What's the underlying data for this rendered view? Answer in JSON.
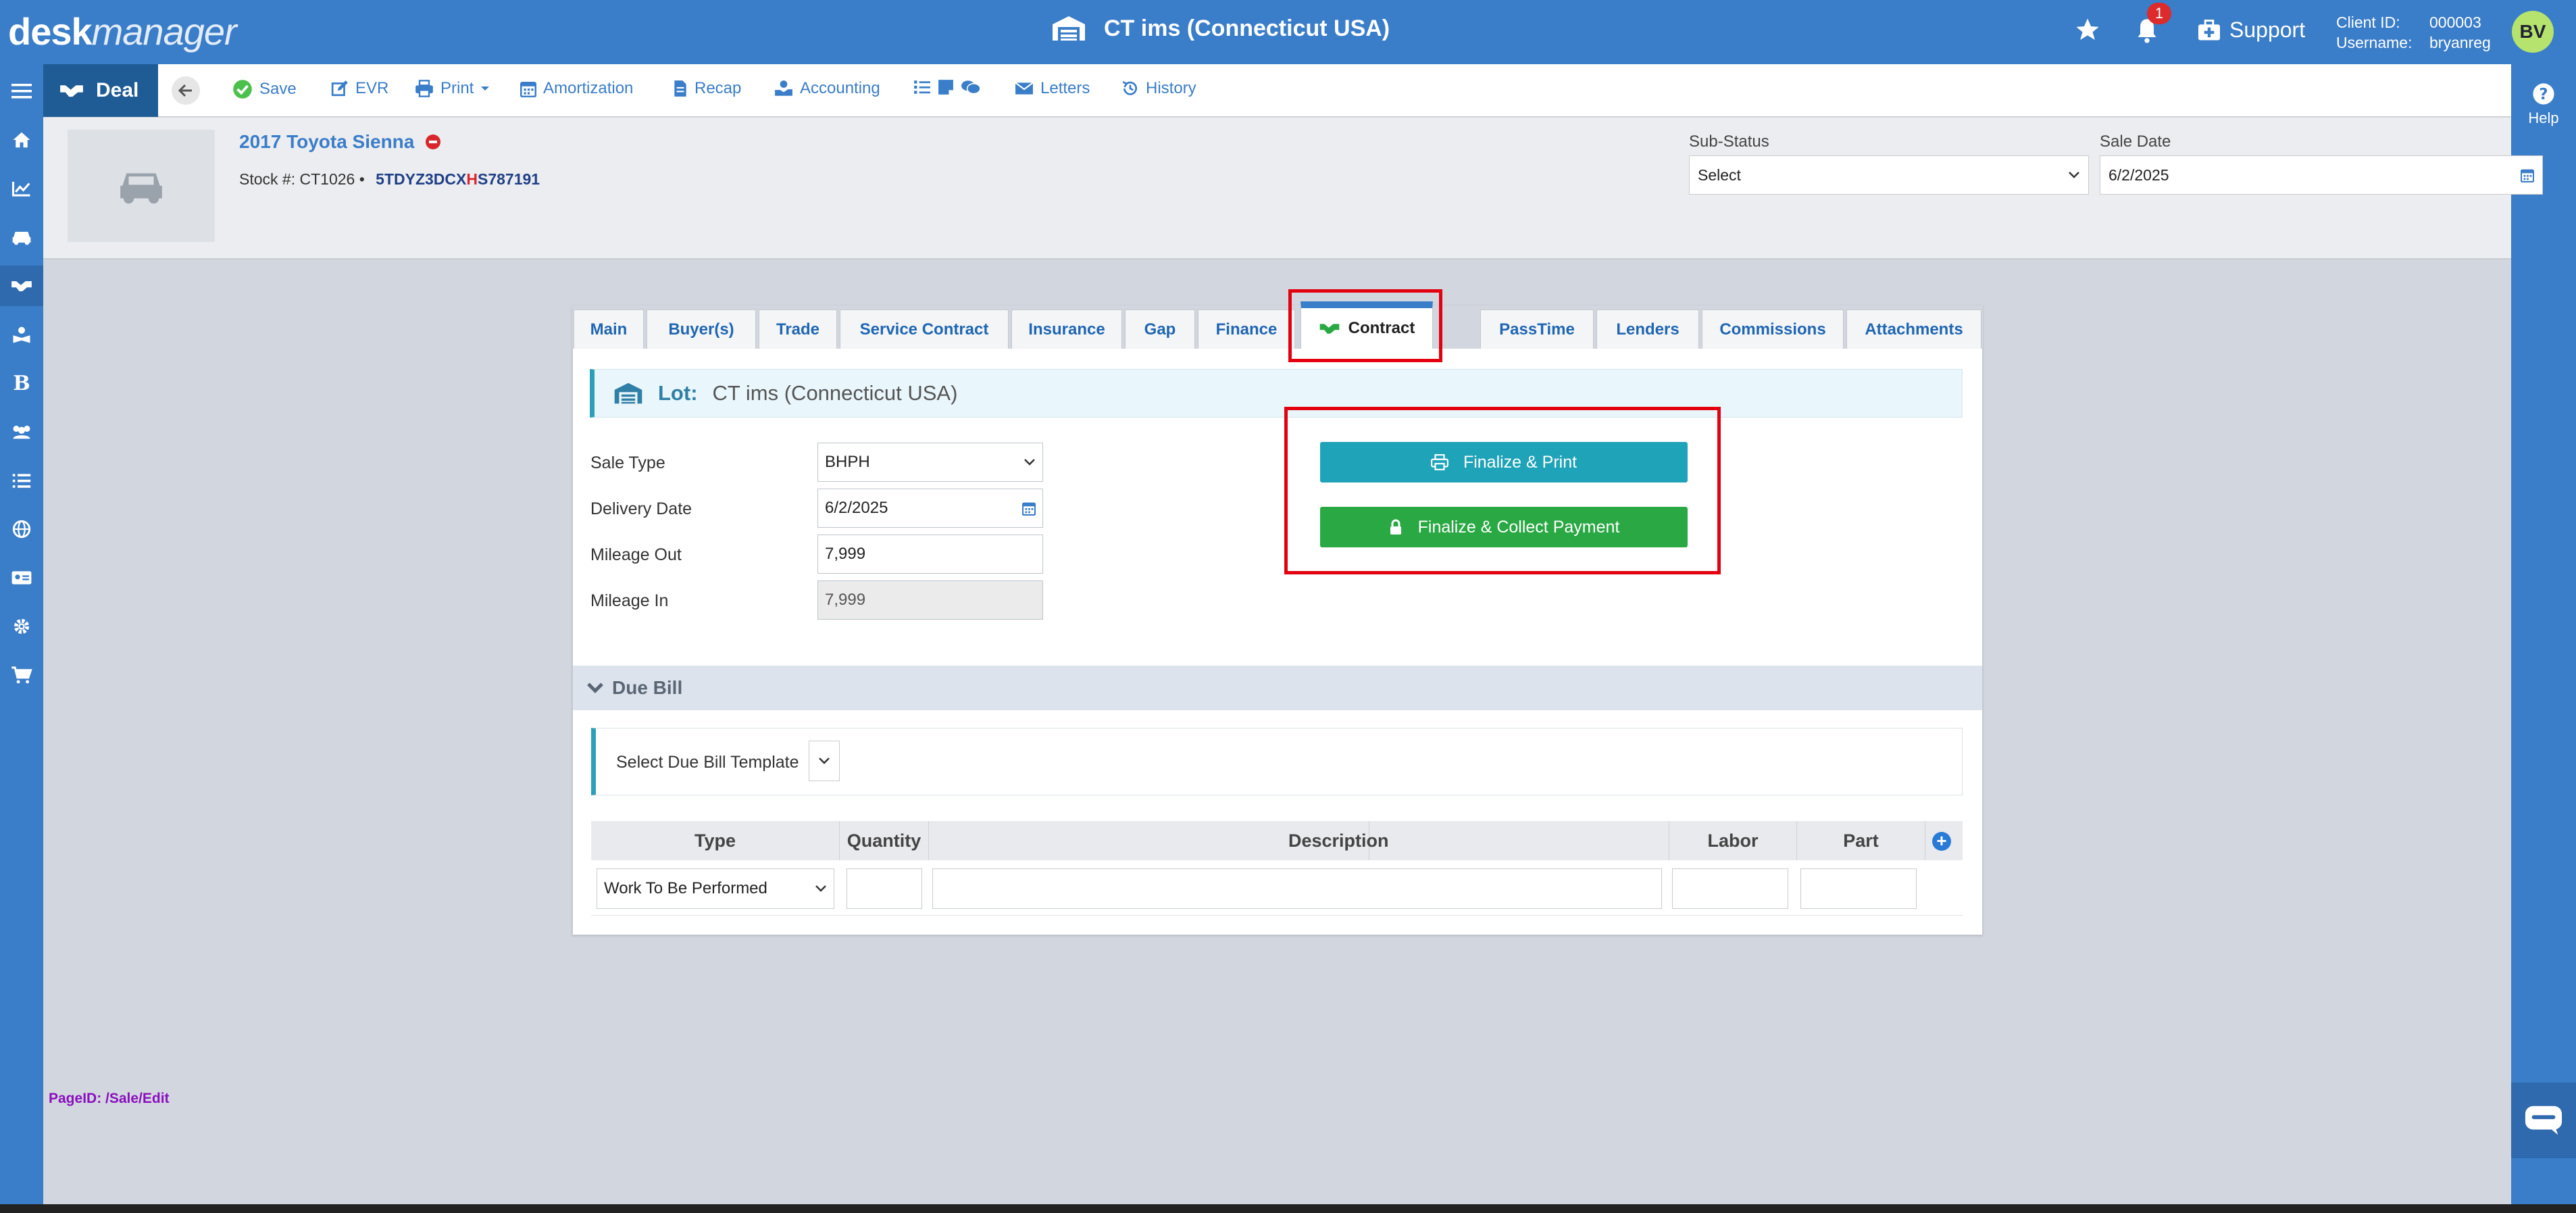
{
  "header": {
    "logo_bold": "desk",
    "logo_italic": "manager",
    "lot_title": "CT ims (Connecticut USA)",
    "notification_count": "1",
    "support_label": "Support",
    "client_id_label": "Client ID:",
    "client_id_value": "000003",
    "username_label": "Username:",
    "username_value": "bryanreg",
    "avatar_initials": "BV"
  },
  "toolbar": {
    "deal_label": "Deal",
    "save": "Save",
    "evr": "EVR",
    "print": "Print",
    "amortization": "Amortization",
    "recap": "Recap",
    "accounting": "Accounting",
    "letters": "Letters",
    "history": "History"
  },
  "help_label": "Help",
  "vehicle": {
    "title": "2017 Toyota Sienna",
    "stock_label": "Stock #:",
    "stock_value": "CT1026",
    "separator": "•",
    "vin_part1": "5TDYZ3DCX",
    "vin_highlight": "H",
    "vin_part2": "S787191"
  },
  "sub_status": {
    "label": "Sub-Status",
    "value": "Select"
  },
  "sale_date": {
    "label": "Sale Date",
    "value": "6/2/2025"
  },
  "tabs": [
    "Main",
    "Buyer(s)",
    "Trade",
    "Service Contract",
    "Insurance",
    "Gap",
    "Finance",
    "Contract",
    "PassTime",
    "Lenders",
    "Commissions",
    "Attachments"
  ],
  "lot": {
    "label": "Lot:",
    "value": "CT ims (Connecticut USA)"
  },
  "form": {
    "sale_type_label": "Sale Type",
    "sale_type_value": "BHPH",
    "delivery_date_label": "Delivery Date",
    "delivery_date_value": "6/2/2025",
    "mileage_out_label": "Mileage Out",
    "mileage_out_value": "7,999",
    "mileage_in_label": "Mileage In",
    "mileage_in_value": "7,999"
  },
  "buttons": {
    "finalize_print": "Finalize & Print",
    "finalize_collect": "Finalize & Collect Payment"
  },
  "due_bill": {
    "header": "Due Bill",
    "template_label": "Select Due Bill Template",
    "columns": [
      "Type",
      "Quantity",
      "Description",
      "Labor",
      "Part"
    ],
    "row_type_value": "Work To Be Performed"
  },
  "page_id": "PageID:  /Sale/Edit",
  "colors": {
    "brand_blue": "#3a7dc9",
    "dark_blue": "#1f5b94",
    "teal": "#1fa3b8",
    "green": "#29a843",
    "highlight_red": "#e3000f"
  }
}
